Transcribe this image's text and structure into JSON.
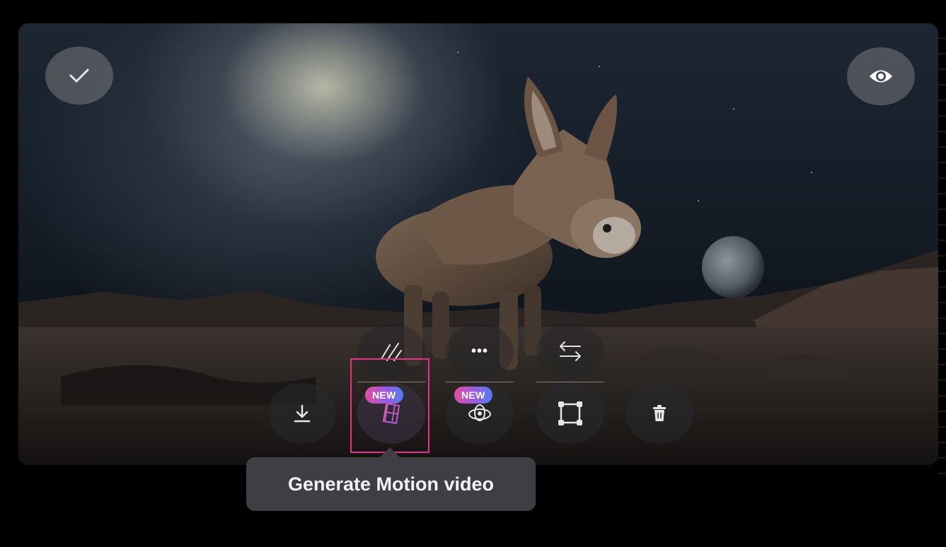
{
  "toolbar": {
    "top_row": [
      {
        "icon": "wand-diagonal-icon"
      },
      {
        "icon": "more-dots-icon",
        "label": "•••"
      },
      {
        "icon": "swap-arrows-icon"
      }
    ],
    "bottom_row": [
      {
        "icon": "download-icon"
      },
      {
        "icon": "motion-video-icon",
        "badge": "NEW"
      },
      {
        "icon": "orbit-3d-icon",
        "badge": "NEW"
      },
      {
        "icon": "crop-frame-icon"
      },
      {
        "icon": "trash-icon"
      }
    ]
  },
  "tooltip": {
    "text": "Generate Motion video"
  },
  "colors": {
    "badge_gradient_start": "#e0509f",
    "badge_gradient_end": "#4f7df0",
    "highlight": "#e8328a",
    "tooltip_bg": "#3f3f43"
  }
}
